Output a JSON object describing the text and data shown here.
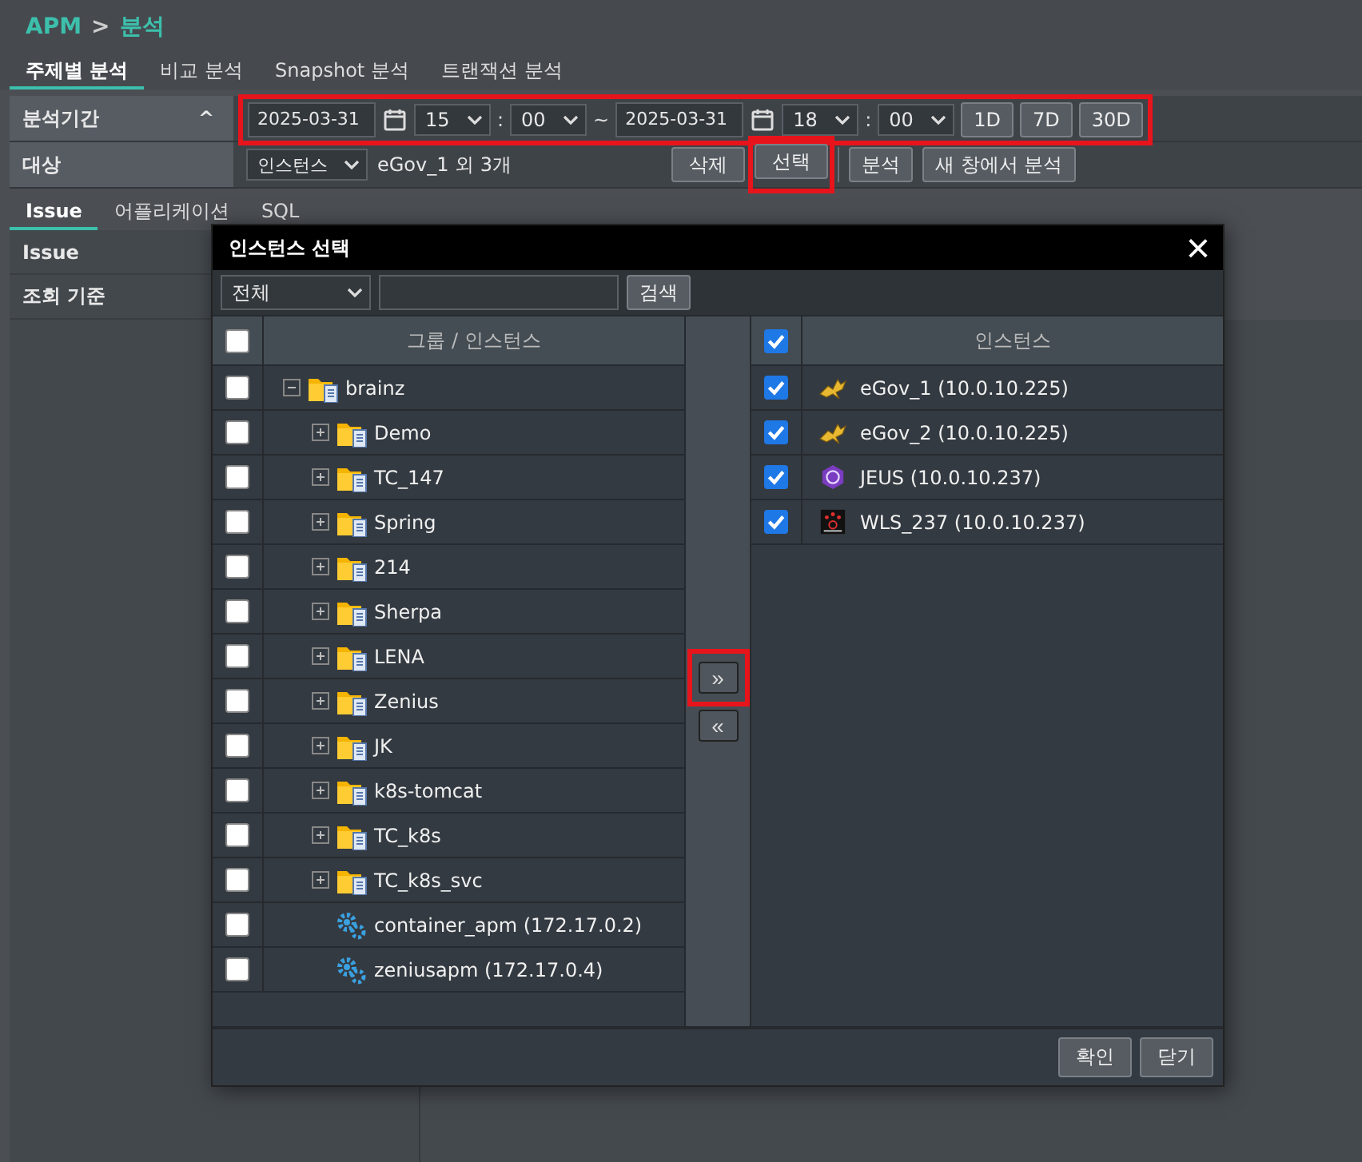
{
  "breadcrumb": {
    "root": "APM",
    "separator": ">",
    "current": "분석"
  },
  "tabs": [
    {
      "label": "주제별 분석",
      "selected": true
    },
    {
      "label": "비교 분석",
      "selected": false
    },
    {
      "label": "Snapshot 분석",
      "selected": false
    },
    {
      "label": "트랜잭션 분석",
      "selected": false
    }
  ],
  "filters": {
    "period_label": "분석기간",
    "collapse_icon": "^",
    "period_highlighted": true,
    "start_date": "2025-03-31",
    "start_hour": "15",
    "start_minute": "00",
    "range_separator": "~",
    "end_date": "2025-03-31",
    "end_hour": "18",
    "end_minute": "00",
    "time_separator": ":",
    "presets": [
      "1D",
      "7D",
      "30D"
    ],
    "target_label": "대상",
    "target_type": "인스턴스",
    "target_summary": "eGov_1 외 3개",
    "delete_button": "삭제",
    "select_button": "선택",
    "select_highlighted": true,
    "analyze_button": "분석",
    "new_window_button": "새 창에서 분석"
  },
  "subtabs": [
    {
      "label": "Issue",
      "selected": true
    },
    {
      "label": "어플리케이션",
      "selected": false
    },
    {
      "label": "SQL",
      "selected": false
    }
  ],
  "side_panel": [
    "Issue",
    "조회 기준"
  ],
  "dialog": {
    "title": "인스턴스 선택",
    "close": "×",
    "filter_value": "전체",
    "search_button": "검색",
    "left_header": "그룹 / 인스턴스",
    "left_all_checked": false,
    "tree": [
      {
        "label": "brainz",
        "kind": "group",
        "expanded": true,
        "checked": false,
        "children": [
          {
            "label": "Demo",
            "kind": "group",
            "expanded": false,
            "checked": false
          },
          {
            "label": "TC_147",
            "kind": "group",
            "expanded": false,
            "checked": false
          },
          {
            "label": "Spring",
            "kind": "group",
            "expanded": false,
            "checked": false
          },
          {
            "label": "214",
            "kind": "group",
            "expanded": false,
            "checked": false
          },
          {
            "label": "Sherpa",
            "kind": "group",
            "expanded": false,
            "checked": false
          },
          {
            "label": "LENA",
            "kind": "group",
            "expanded": false,
            "checked": false
          },
          {
            "label": "Zenius",
            "kind": "group",
            "expanded": false,
            "checked": false
          },
          {
            "label": "JK",
            "kind": "group",
            "expanded": false,
            "checked": false
          },
          {
            "label": "k8s-tomcat",
            "kind": "group",
            "expanded": false,
            "checked": false
          },
          {
            "label": "TC_k8s",
            "kind": "group",
            "expanded": false,
            "checked": false
          },
          {
            "label": "TC_k8s_svc",
            "kind": "group",
            "expanded": false,
            "checked": false
          },
          {
            "label": "container_apm (172.17.0.2)",
            "kind": "instance",
            "checked": false
          },
          {
            "label": "zeniusapm (172.17.0.4)",
            "kind": "instance",
            "checked": false
          }
        ]
      }
    ],
    "add_button": "»",
    "add_highlighted": true,
    "remove_button": "«",
    "right_header": "인스턴스",
    "right_all_checked": true,
    "selected_instances": [
      {
        "label": "eGov_1 (10.0.10.225)",
        "kind": "tomcat",
        "checked": true
      },
      {
        "label": "eGov_2 (10.0.10.225)",
        "kind": "tomcat",
        "checked": true
      },
      {
        "label": "JEUS (10.0.10.237)",
        "kind": "jeus",
        "checked": true
      },
      {
        "label": "WLS_237 (10.0.10.237)",
        "kind": "weblogic",
        "checked": true
      }
    ],
    "ok_button": "확인",
    "close_button": "닫기"
  }
}
